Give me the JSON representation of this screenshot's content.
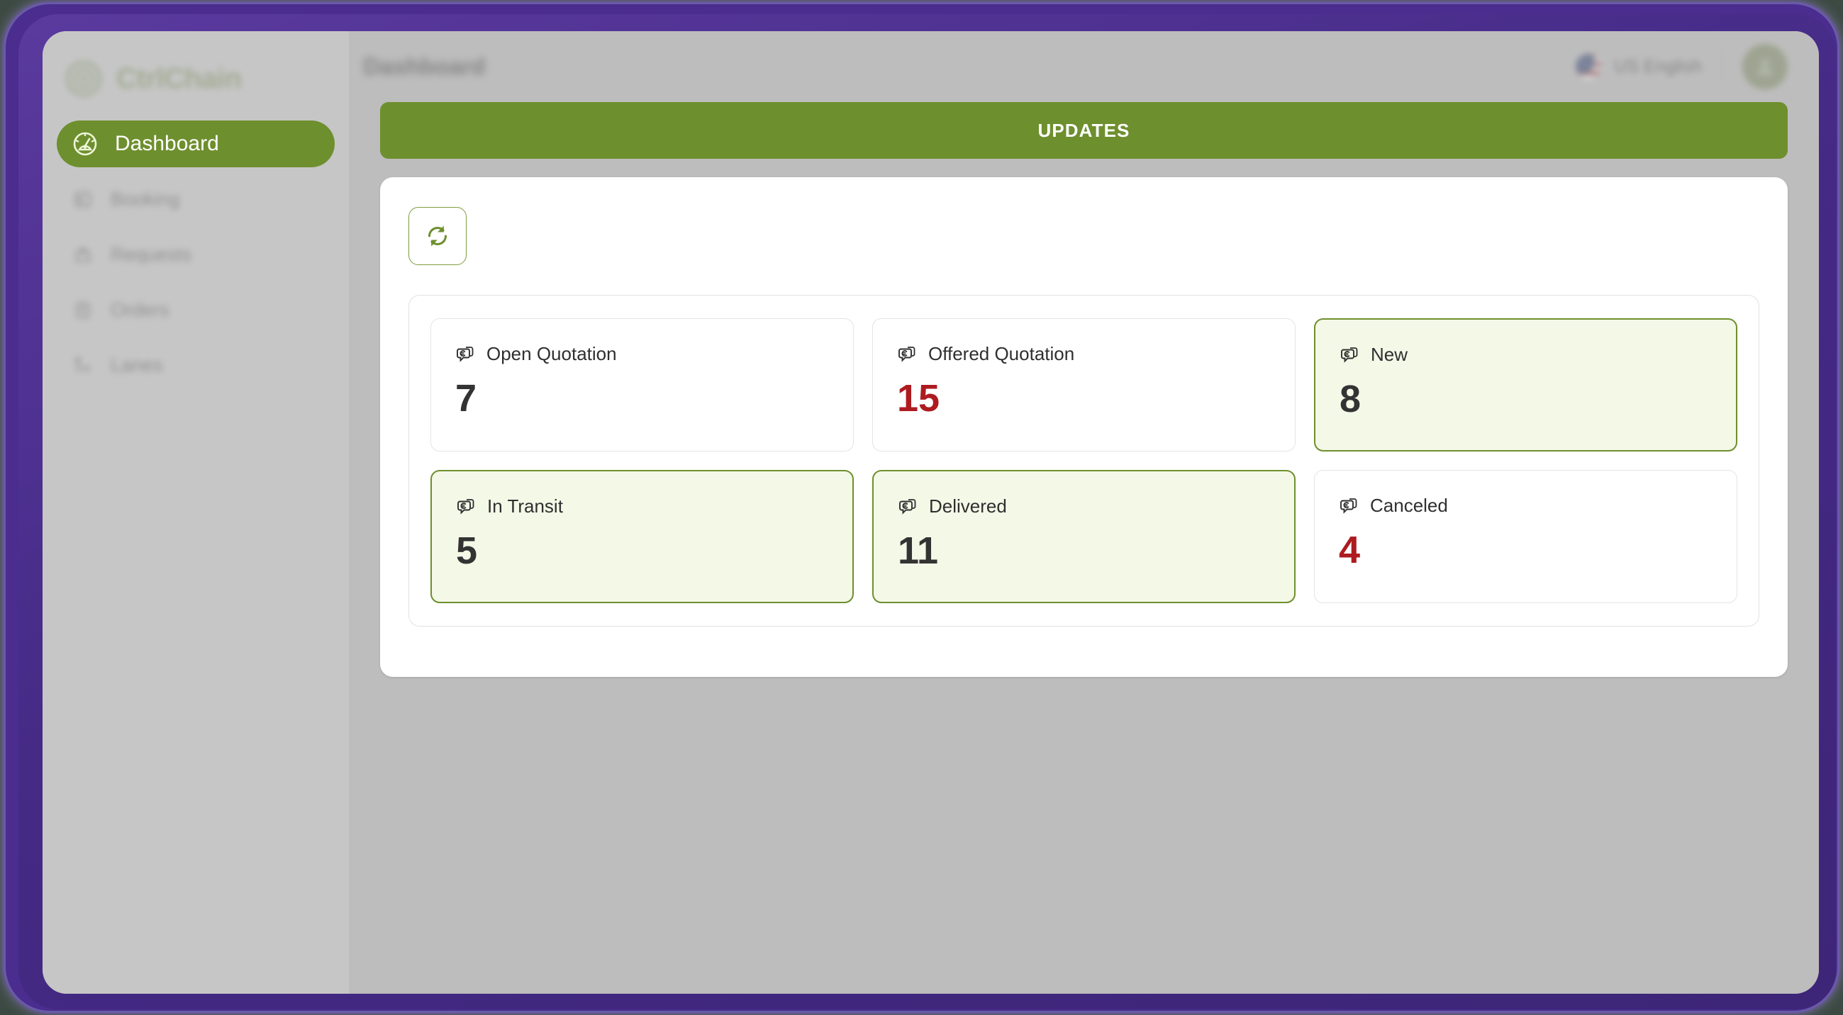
{
  "brand": {
    "name": "CtrlChain",
    "logo_icon": "target-circle-icon",
    "accent_color": "#7d9a4e"
  },
  "sidebar": {
    "items": [
      {
        "label": "Dashboard",
        "icon": "speedometer-icon",
        "active": true
      },
      {
        "label": "Booking",
        "icon": "booking-icon",
        "active": false
      },
      {
        "label": "Requests",
        "icon": "requests-icon",
        "active": false
      },
      {
        "label": "Orders",
        "icon": "orders-icon",
        "active": false
      },
      {
        "label": "Lanes",
        "icon": "lanes-icon",
        "active": false
      }
    ]
  },
  "topbar": {
    "page_title": "Dashboard",
    "language": "US English",
    "flag_icon": "us-flag-icon",
    "avatar_icon": "user-avatar",
    "avatar_initial": "A"
  },
  "banner": {
    "label": "UPDATES",
    "background_color": "#6e8f2e"
  },
  "toolbar": {
    "refresh_icon": "refresh-icon",
    "refresh_label": "Refresh"
  },
  "stats": {
    "cards": [
      {
        "label": "Open Quotation",
        "value": "7",
        "icon": "euro-quotation-icon",
        "highlight": false,
        "value_color": "#333333"
      },
      {
        "label": "Offered Quotation",
        "value": "15",
        "icon": "euro-quotation-icon",
        "highlight": false,
        "value_color": "#ad1b21"
      },
      {
        "label": "New",
        "value": "8",
        "icon": "euro-quotation-icon",
        "highlight": true,
        "value_color": "#333333"
      },
      {
        "label": "In Transit",
        "value": "5",
        "icon": "euro-quotation-icon",
        "highlight": true,
        "value_color": "#333333"
      },
      {
        "label": "Delivered",
        "value": "11",
        "icon": "euro-quotation-icon",
        "highlight": true,
        "value_color": "#333333"
      },
      {
        "label": "Canceled",
        "value": "4",
        "icon": "euro-quotation-icon",
        "highlight": false,
        "value_color": "#ad1b21"
      }
    ]
  },
  "theme": {
    "frame_color": "#4a2d8e",
    "accent_green": "#6e8f2e",
    "highlight_bg": "#f4f8e7",
    "danger_red": "#ad1b21"
  }
}
